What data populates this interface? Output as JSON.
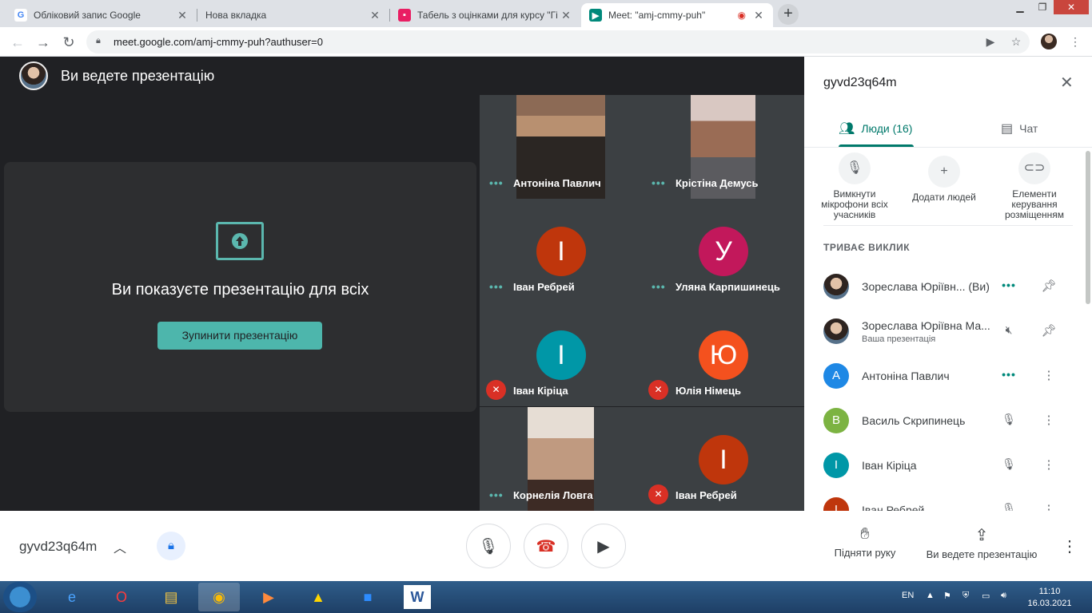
{
  "browser": {
    "tabs": [
      {
        "title": "Обліковий запис Google",
        "favicon": "G"
      },
      {
        "title": "Нова вкладка",
        "favicon": ""
      },
      {
        "title": "Табель з оцінками для курсу \"Гі",
        "favicon": "classroom"
      },
      {
        "title": "Meet: \"amj-cmmy-puh\"",
        "favicon": "meet"
      }
    ],
    "url": "meet.google.com/amj-cmmy-puh?authuser=0"
  },
  "stage": {
    "presenting_header": "Ви ведете презентацію",
    "present_message": "Ви показуєте презентацію для всіх",
    "stop_button": "Зупинити презентацію",
    "tiles": [
      {
        "name": "Антоніна Павлич",
        "type": "video",
        "status": "speaking"
      },
      {
        "name": "Крістіна Демусь",
        "type": "video",
        "status": "speaking"
      },
      {
        "name": "Іван Ребрей",
        "letter": "І",
        "color": "#bf360c",
        "status": "speaking"
      },
      {
        "name": "Уляна Карпишинець",
        "letter": "У",
        "color": "#c2185b",
        "status": "speaking"
      },
      {
        "name": "Іван Кіріца",
        "letter": "І",
        "color": "#0097a7",
        "status": "muted"
      },
      {
        "name": "Юлія Німець",
        "letter": "Ю",
        "color": "#f4511e",
        "status": "muted"
      },
      {
        "name": "Корнелія Ловга",
        "type": "video",
        "status": "speaking"
      },
      {
        "name": "Іван Ребрей",
        "letter": "І",
        "color": "#bf360c",
        "status": "muted"
      }
    ]
  },
  "panel": {
    "meeting_code": "gyvd23q64m",
    "tab_people": "Люди (16)",
    "tab_chat": "Чат",
    "actions": [
      {
        "label": "Вимкнути мікрофони всіх учасників"
      },
      {
        "label": "Додати людей"
      },
      {
        "label": "Елементи керування розміщенням"
      }
    ],
    "section_title": "ТРИВАЄ ВИКЛИК",
    "people": [
      {
        "name": "Зореслава Юріївн...",
        "suffix": "(Ви)",
        "sub": "",
        "letter": "",
        "color": "",
        "a1": "dots",
        "a2": "pin"
      },
      {
        "name": "Зореслава Юріївна Ма...",
        "suffix": "",
        "sub": "Ваша презентація",
        "letter": "",
        "color": "",
        "a1": "speaker-off",
        "a2": "pin"
      },
      {
        "name": "Антоніна Павлич",
        "suffix": "",
        "sub": "",
        "letter": "А",
        "color": "#1e88e5",
        "a1": "dots",
        "a2": "more"
      },
      {
        "name": "Василь Скрипинець",
        "suffix": "",
        "sub": "",
        "letter": "В",
        "color": "#7cb342",
        "a1": "mic-off",
        "a2": "more"
      },
      {
        "name": "Іван Кіріца",
        "suffix": "",
        "sub": "",
        "letter": "І",
        "color": "#0097a7",
        "a1": "mic-off",
        "a2": "more"
      },
      {
        "name": "Іван Ребрей",
        "suffix": "",
        "sub": "",
        "letter": "І",
        "color": "#bf360c",
        "a1": "mic-off",
        "a2": "more"
      }
    ]
  },
  "bottom": {
    "meeting_code": "gyvd23q64m",
    "raise_hand": "Підняти руку",
    "presenting": "Ви ведете презентацію"
  },
  "taskbar": {
    "lang": "EN",
    "time": "11:10",
    "date": "16.03.2021"
  },
  "colors": {
    "accent": "#00796b",
    "present_green": "#4db6ac",
    "muted_red": "#d93025"
  }
}
